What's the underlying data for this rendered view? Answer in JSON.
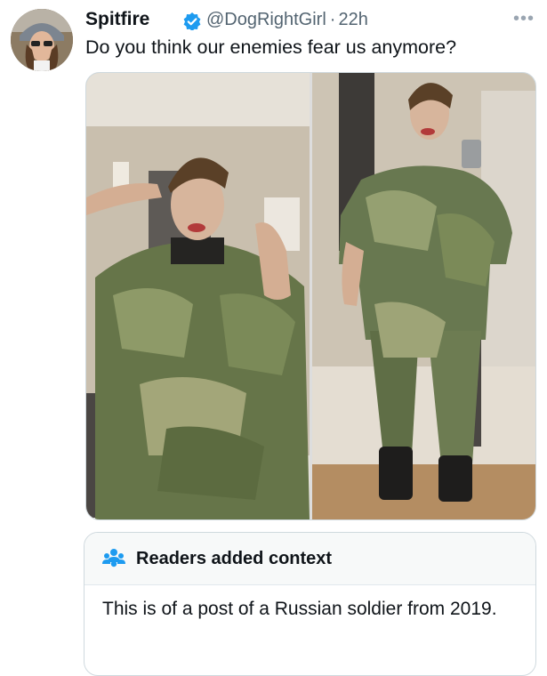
{
  "tweet": {
    "display_name": "Spitfire",
    "handle": "@DogRightGirl",
    "separator": "·",
    "time": "22h",
    "text": "Do you think our enemies fear us anymore?",
    "more_icon": "more-dots-icon",
    "verified_icon": "verified-badge-icon"
  },
  "note": {
    "title": "Readers added context",
    "icon": "people-icon",
    "body": "This is of a post of a Russian soldier from 2019."
  },
  "colors": {
    "text": "#0f1419",
    "secondary": "#536471",
    "accent": "#1d9bf0",
    "border": "#cfd9de",
    "note_header_bg": "#f7f9f9"
  }
}
